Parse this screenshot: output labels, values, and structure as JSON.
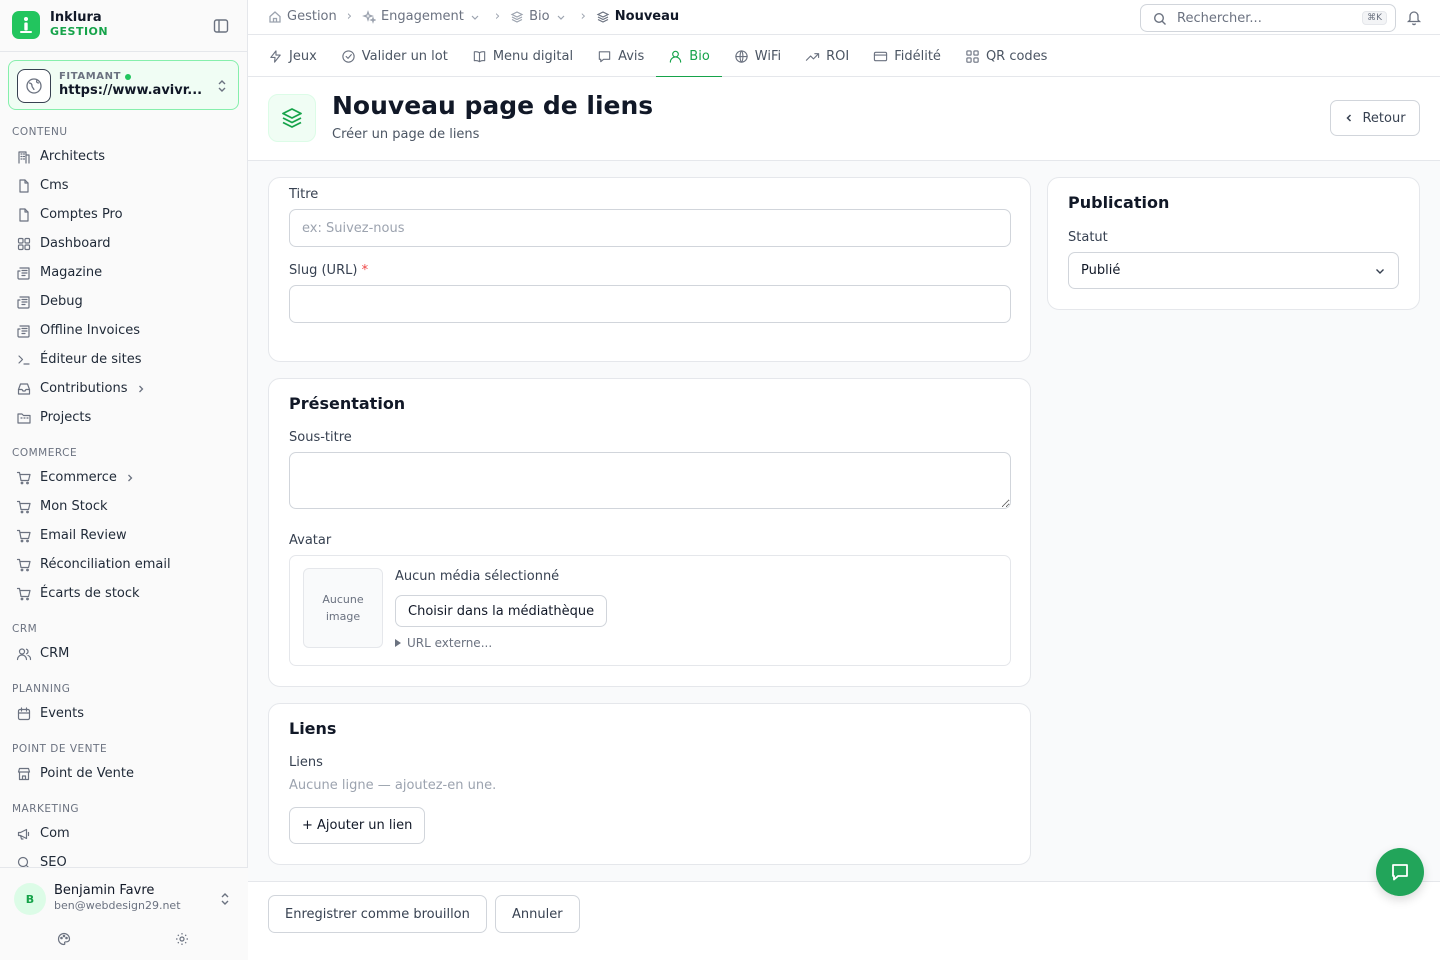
{
  "brand": {
    "name": "Inklura",
    "sub": "GESTION"
  },
  "site": {
    "label": "FITAMANT",
    "url": "https://www.avivr..."
  },
  "nav_sections": [
    {
      "title": "CONTENU",
      "items": [
        {
          "label": "Architects",
          "icon": "building-icon"
        },
        {
          "label": "Cms",
          "icon": "file-icon"
        },
        {
          "label": "Comptes Pro",
          "icon": "file-icon"
        },
        {
          "label": "Dashboard",
          "icon": "grid-icon"
        },
        {
          "label": "Magazine",
          "icon": "newspaper-icon"
        },
        {
          "label": "Debug",
          "icon": "newspaper-icon"
        },
        {
          "label": "Offline Invoices",
          "icon": "newspaper-icon"
        },
        {
          "label": "Éditeur de sites",
          "icon": "terminal-icon"
        },
        {
          "label": "Contributions",
          "icon": "inbox-icon",
          "submenu": true
        },
        {
          "label": "Projects",
          "icon": "folder-icon"
        }
      ]
    },
    {
      "title": "COMMERCE",
      "items": [
        {
          "label": "Ecommerce",
          "icon": "cart-icon",
          "submenu": true
        },
        {
          "label": "Mon Stock",
          "icon": "cart-icon"
        },
        {
          "label": "Email Review",
          "icon": "cart-icon"
        },
        {
          "label": "Réconciliation email",
          "icon": "cart-icon"
        },
        {
          "label": "Écarts de stock",
          "icon": "cart-icon"
        }
      ]
    },
    {
      "title": "CRM",
      "items": [
        {
          "label": "CRM",
          "icon": "users-icon"
        }
      ]
    },
    {
      "title": "PLANNING",
      "items": [
        {
          "label": "Events",
          "icon": "calendar-icon"
        }
      ]
    },
    {
      "title": "POINT DE VENTE",
      "items": [
        {
          "label": "Point de Vente",
          "icon": "store-icon"
        }
      ]
    },
    {
      "title": "MARKETING",
      "items": [
        {
          "label": "Com",
          "icon": "megaphone-icon"
        },
        {
          "label": "SEO",
          "icon": "search-icon"
        }
      ]
    }
  ],
  "user": {
    "initial": "B",
    "name": "Benjamin Favre",
    "email": "ben@webdesign29.net"
  },
  "breadcrumbs": {
    "home": "Gestion",
    "engagement": "Engagement",
    "bio": "Bio",
    "current": "Nouveau"
  },
  "search": {
    "placeholder": "Rechercher...",
    "shortcut": "⌘K"
  },
  "tabs": [
    {
      "label": "Jeux",
      "icon": "zap-icon",
      "active": false
    },
    {
      "label": "Valider un lot",
      "icon": "check-circle-icon",
      "active": false
    },
    {
      "label": "Menu digital",
      "icon": "book-icon",
      "active": false
    },
    {
      "label": "Avis",
      "icon": "message-icon",
      "active": false
    },
    {
      "label": "Bio",
      "icon": "user-icon",
      "active": true
    },
    {
      "label": "WiFi",
      "icon": "globe-icon",
      "active": false
    },
    {
      "label": "ROI",
      "icon": "trend-icon",
      "active": false
    },
    {
      "label": "Fidélité",
      "icon": "card-icon",
      "active": false
    },
    {
      "label": "QR codes",
      "icon": "qr-icon",
      "active": false
    }
  ],
  "page": {
    "title": "Nouveau page de liens",
    "subtitle": "Créer un page de liens",
    "back_label": "Retour"
  },
  "form": {
    "titre_label": "Titre",
    "titre_placeholder": "ex: Suivez-nous",
    "titre_value": "",
    "slug_label": "Slug (URL)",
    "slug_required": "*",
    "slug_value": "",
    "presentation_title": "Présentation",
    "sous_titre_label": "Sous-titre",
    "sous_titre_value": "",
    "avatar_label": "Avatar",
    "avatar_empty": "Aucune image",
    "avatar_none_selected": "Aucun média sélectionné",
    "avatar_choose": "Choisir dans la médiathèque",
    "avatar_external": "URL externe...",
    "liens_title": "Liens",
    "liens_label": "Liens",
    "liens_empty": "Aucune ligne — ajoutez-en une.",
    "liens_add": "+ Ajouter un lien"
  },
  "publication": {
    "title": "Publication",
    "statut_label": "Statut",
    "statut_value": "Publié"
  },
  "footer": {
    "draft": "Enregistrer comme brouillon",
    "cancel": "Annuler"
  },
  "colors": {
    "accent": "#16a34a",
    "brand": "#22c55e"
  }
}
